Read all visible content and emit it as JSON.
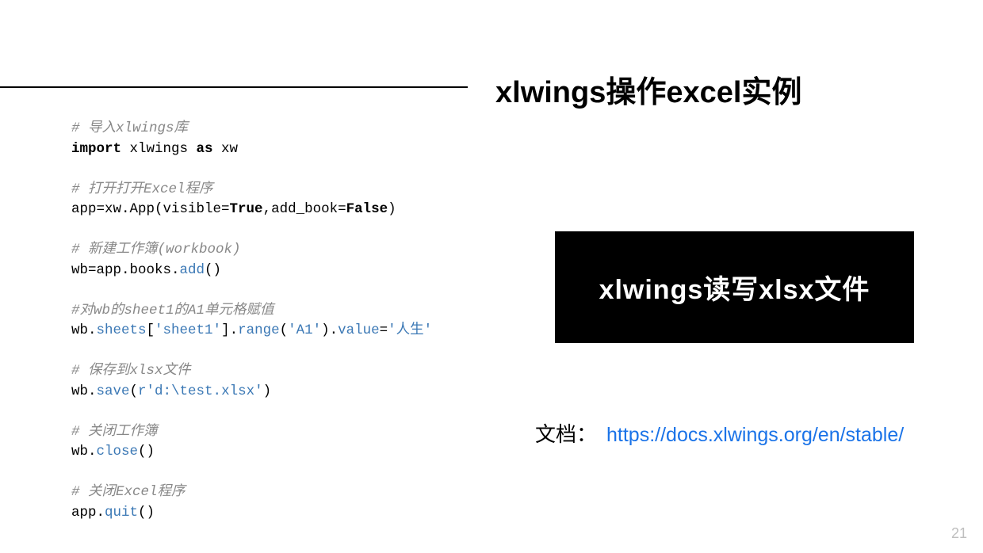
{
  "title": "xlwings操作excel实例",
  "box_label": "xlwings读写xlsx文件",
  "doc_label": "文档：",
  "doc_link_text": "https://docs.xlwings.org/en/stable/",
  "page_number": "21",
  "code": {
    "c1": "# 导入xlwings库",
    "l2a": "import",
    "l2b": " xlwings ",
    "l2c": "as",
    "l2d": " xw",
    "c3": "# 打开打开Excel程序",
    "l4a": "app=xw.App(visible=",
    "l4b": "True",
    "l4c": ",add_book=",
    "l4d": "False",
    "l4e": ")",
    "c5": "# 新建工作簿(workbook)",
    "l6a": "wb=app.books.",
    "l6b": "add",
    "l6c": "()",
    "c7": "#对wb的sheet1的A1单元格赋值",
    "l8a": "wb.",
    "l8b": "sheets",
    "l8c": "[",
    "l8d": "'sheet1'",
    "l8e": "].",
    "l8f": "range",
    "l8g": "(",
    "l8h": "'A1'",
    "l8i": ").",
    "l8j": "value",
    "l8k": "=",
    "l8l": "'人生'",
    "c9": "# 保存到xlsx文件",
    "l10a": "wb.",
    "l10b": "save",
    "l10c": "(",
    "l10d": "r'd:\\test.xlsx'",
    "l10e": ")",
    "c11": "# 关闭工作簿",
    "l12a": "wb.",
    "l12b": "close",
    "l12c": "()",
    "c13": "# 关闭Excel程序",
    "l14a": "app.",
    "l14b": "quit",
    "l14c": "()"
  }
}
